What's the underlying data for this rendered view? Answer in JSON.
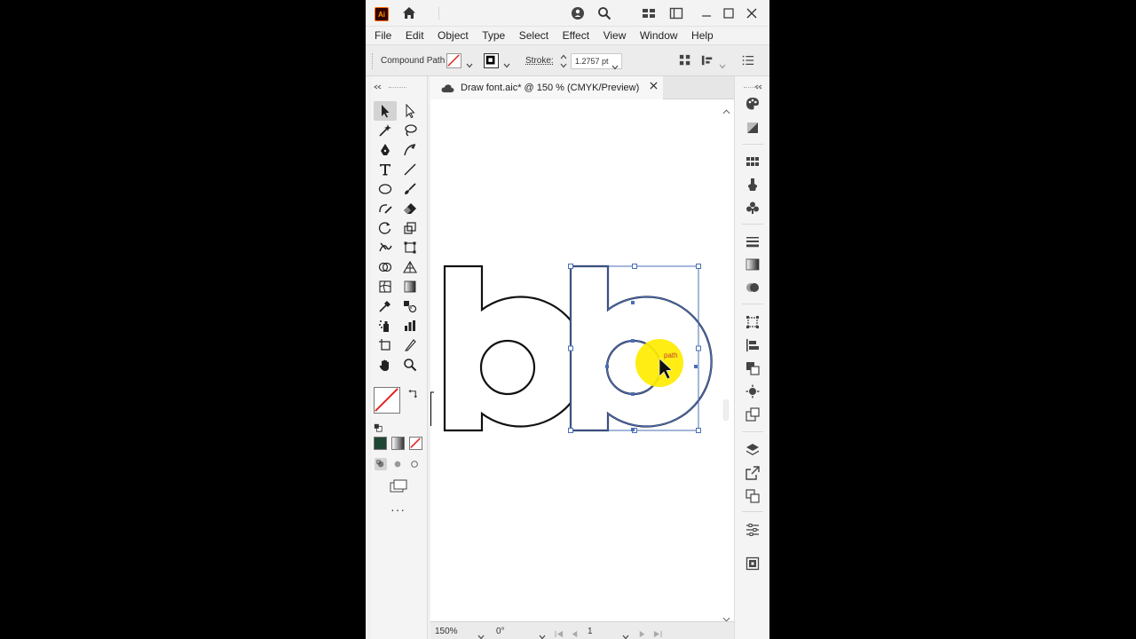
{
  "app": {
    "logo_text": "Ai"
  },
  "menu": [
    "File",
    "Edit",
    "Object",
    "Type",
    "Select",
    "Effect",
    "View",
    "Window",
    "Help"
  ],
  "controlbar": {
    "selection_type": "Compound Path",
    "stroke_label": "Stroke:",
    "stroke_value": "1.2757 pt"
  },
  "document": {
    "tab_title": "Draw font.aic* @ 150 % (CMYK/Preview)"
  },
  "canvas": {
    "tooltip_text": "path"
  },
  "status": {
    "zoom": "150%",
    "rotation": "0°",
    "artboard": "1"
  },
  "colors": {
    "accent": "#4a6fb4",
    "highlight": "#ffeb00",
    "tooltip_text": "#c0392b"
  }
}
